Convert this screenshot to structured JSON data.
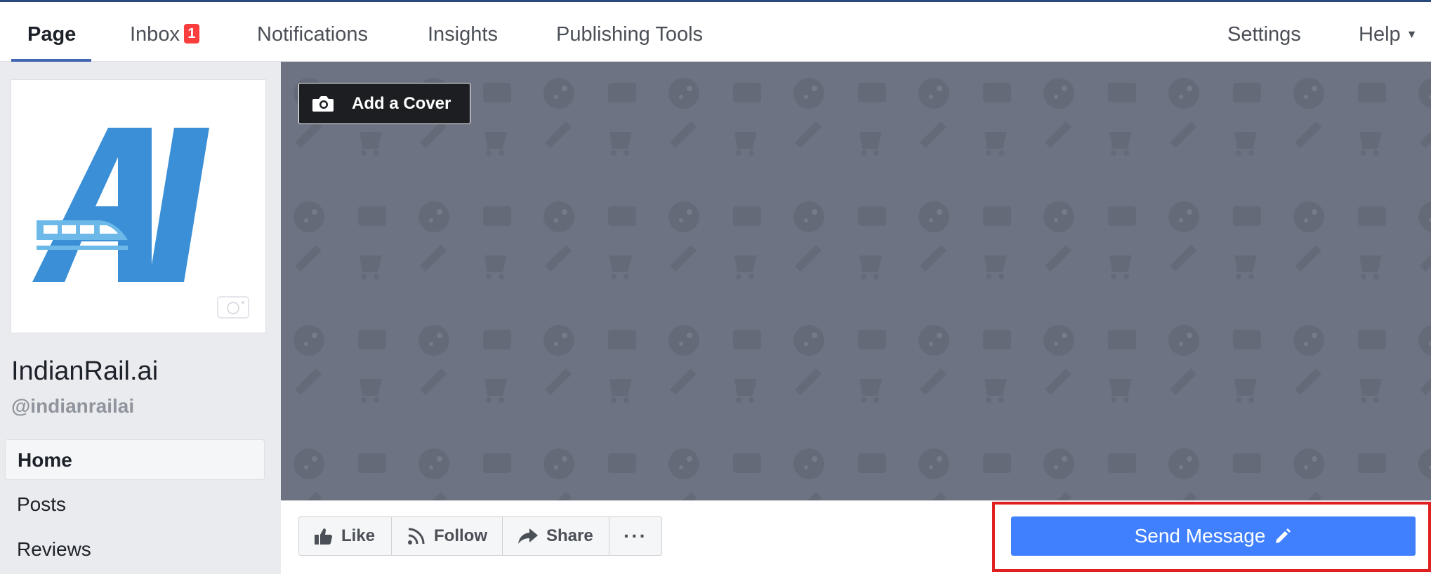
{
  "nav": {
    "page": "Page",
    "inbox": "Inbox",
    "inbox_badge": "1",
    "notifications": "Notifications",
    "insights": "Insights",
    "publishing_tools": "Publishing Tools",
    "settings": "Settings",
    "help": "Help"
  },
  "profile": {
    "name": "IndianRail.ai",
    "handle": "@indianrailai",
    "logo_text": "AI",
    "logo_color": "#3a8fd6",
    "train_color": "#6cb8e8"
  },
  "sidebar": {
    "items": [
      {
        "label": "Home",
        "active": true
      },
      {
        "label": "Posts",
        "active": false
      },
      {
        "label": "Reviews",
        "active": false
      }
    ]
  },
  "cover": {
    "add_cover_label": "Add a Cover",
    "bg_color": "#6d7382"
  },
  "actions": {
    "like": "Like",
    "follow": "Follow",
    "share": "Share",
    "more": "···",
    "send_message": "Send Message"
  },
  "colors": {
    "accent": "#4267b2",
    "send_button": "#4080ff",
    "highlight": "#e02020",
    "badge": "#fa3e3e"
  }
}
